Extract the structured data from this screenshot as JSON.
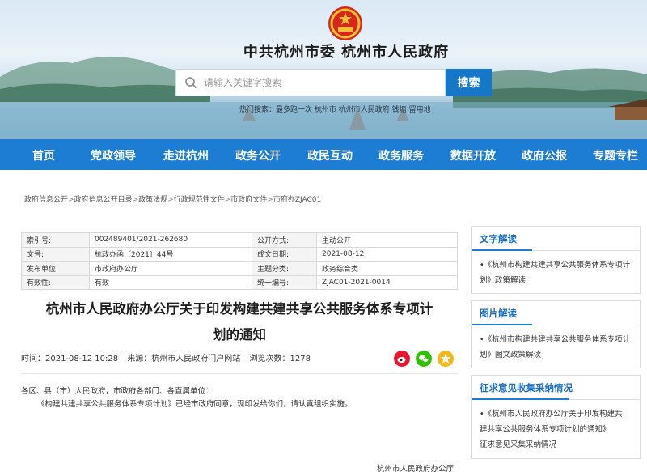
{
  "header": {
    "site_title": "中共杭州市委   杭州市人民政府",
    "search_placeholder": "请输入关键字搜索",
    "search_button": "搜索",
    "hot_words": "热门搜索：最多跑一次   杭州市   杭州市人民政府   钱塘   留用地"
  },
  "nav": {
    "items": [
      "首页",
      "党政领导",
      "走进杭州",
      "政务公开",
      "政民互动",
      "政务服务",
      "数据开放",
      "政府公报",
      "专题专栏"
    ]
  },
  "breadcrumb": [
    "政府信息公开",
    "政府信息公开目录",
    "政策法规",
    "行政规范性文件",
    "市政府文件",
    "市府办ZJAC01"
  ],
  "info": {
    "rows": [
      {
        "k1": "索引号:",
        "v1": "002489401/2021-262680",
        "k2": "公开方式:",
        "v2": "主动公开"
      },
      {
        "k1": "文号:",
        "v1": "杭政办函〔2021〕44号",
        "k2": "成文日期:",
        "v2": "2021-08-12"
      },
      {
        "k1": "发布单位:",
        "v1": "市政府办公厅",
        "k2": "主题分类:",
        "v2": "政务综合类"
      },
      {
        "k1": "有效性:",
        "v1": "有效",
        "k2": "统一编号:",
        "v2": "ZJAC01-2021-0014"
      }
    ]
  },
  "article": {
    "title_line1": "杭州市人民政府办公厅关于印发构建共建共享公共服务体系专项计",
    "title_line2": "划的通知",
    "time": "时间：2021-08-12 10:28",
    "source": "来源：杭州市人民政府门户网站",
    "views": "浏览次数：1278",
    "body_line1": "各区、县（市）人民政府，市政府各部门、各直属单位：",
    "body_line2": "《构建共建共享公共服务体系专项计划》已经市政府同意，现印发给你们，请认真组织实施。",
    "signature": "杭州市人民政府办公厅"
  },
  "sidebar": {
    "boxes": [
      {
        "title": "文字解读",
        "lines": [
          "•《杭州市构建共建共享公共服务体系专项计",
          "划》政策解读"
        ]
      },
      {
        "title": "图片解读",
        "lines": [
          "•《杭州市构建共建共享公共服务体系专项计",
          "划》图文政策解读"
        ]
      },
      {
        "title": "征求意见收集采纳情况",
        "lines": [
          "•《杭州市人民政府办公厅关于印发构建共",
          "建共享公共服务体系专项计划的通知》",
          "征求意见采集采纳情况"
        ]
      }
    ]
  },
  "colors": {
    "nav_blue": "#1c7dd3",
    "search_blue": "#1677c9",
    "sidebar_title_blue": "#1c6fc0",
    "weibo_red": "#e6162d",
    "wechat_green": "#2dc100",
    "qzone_yellow": "#f5b617"
  },
  "icons": {
    "emblem": "national-emblem-icon",
    "search": "search-icon",
    "share": [
      "weibo-icon",
      "wechat-icon",
      "qzone-icon"
    ]
  }
}
